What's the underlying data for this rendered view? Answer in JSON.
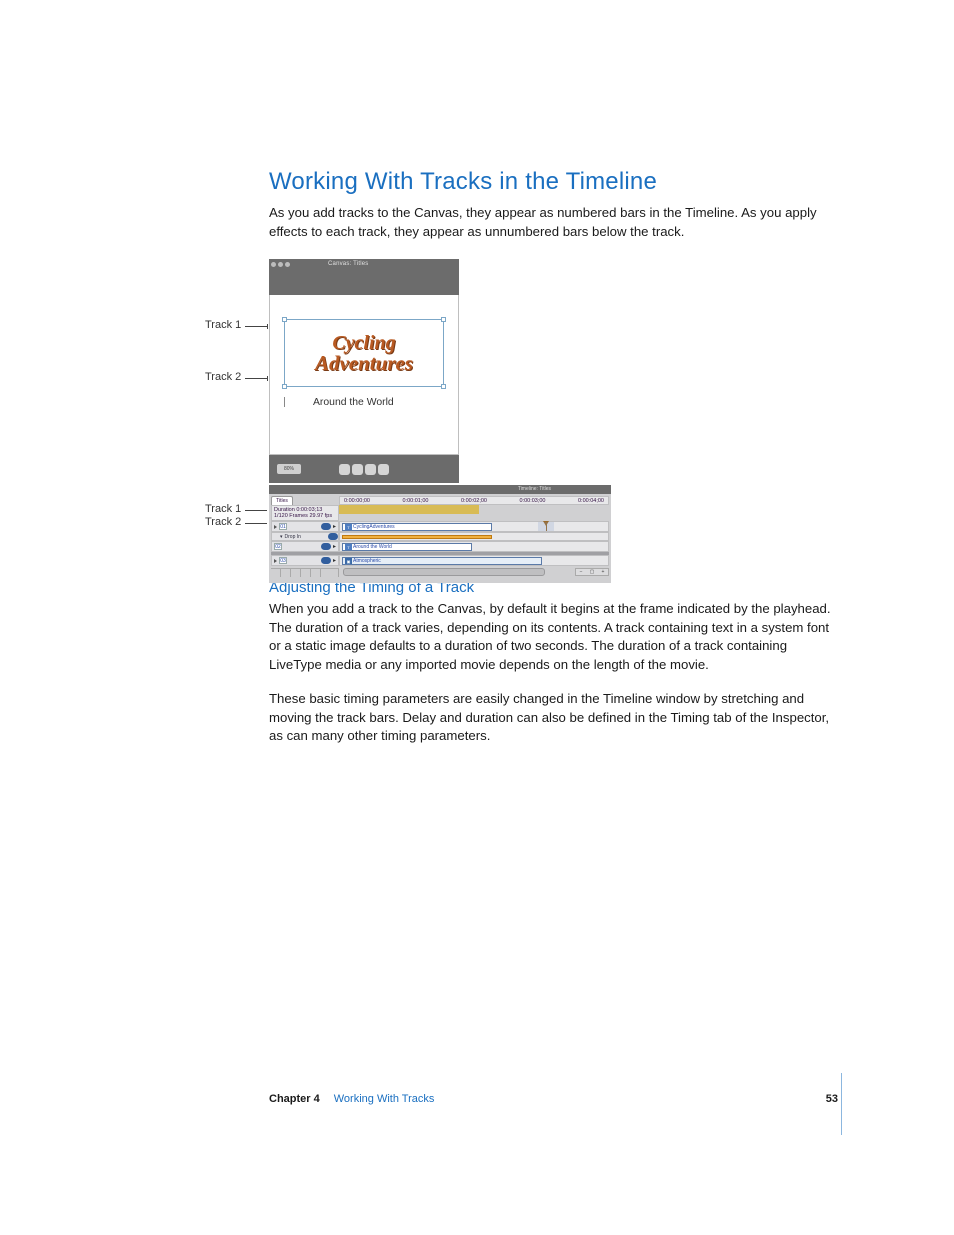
{
  "heading": "Working With Tracks in the Timeline",
  "intro": "As you add tracks to the Canvas, they appear as numbered bars in the Timeline. As you apply effects to each track, they appear as unnumbered bars below the track.",
  "callouts": {
    "canvas_t1": "Track 1",
    "canvas_t2": "Track 2",
    "timeline_t1": "Track 1",
    "timeline_t2": "Track 2"
  },
  "canvas": {
    "window_title": "Canvas: Titles",
    "title_l1": "Cycling",
    "title_l2": "Adventures",
    "subtitle": "Around the World",
    "zoom_chip": "80%"
  },
  "timeline": {
    "window_title": "Timeline: Titles",
    "tab": "Titles",
    "meta1": "Duration  0:00:03;13",
    "meta2": "1/120 Frames  29.97 fps",
    "ruler": [
      "0:00:00;00",
      "0:00:01;00",
      "0:00:02;00",
      "0:00:03;00",
      "0:00:04;00"
    ],
    "tracks": [
      {
        "num": "01",
        "clip": "CyclingAdventures",
        "effect": "Drop In"
      },
      {
        "num": "02",
        "clip": "Around the World"
      },
      {
        "num": "03",
        "clip": "Atmospheric"
      }
    ],
    "zoom": [
      "−",
      "▢",
      "+"
    ]
  },
  "subheading": "Adjusting the Timing of a Track",
  "para2": "When you add a track to the Canvas, by default it begins at the frame indicated by the playhead. The duration of a track varies, depending on its contents. A track containing text in a system font or a static image defaults to a duration of two seconds. The duration of a track containing LiveType media or any imported movie depends on the length of the movie.",
  "para3": "These basic timing parameters are easily changed in the Timeline window by stretching and moving the track bars. Delay and duration can also be defined in the Timing tab of the Inspector, as can many other timing parameters.",
  "footer": {
    "chapter": "Chapter 4",
    "title": "Working With Tracks",
    "page": "53"
  }
}
